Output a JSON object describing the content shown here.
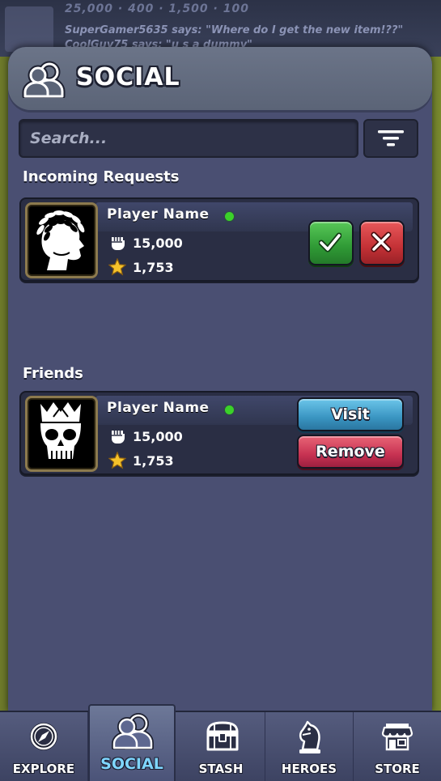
{
  "background": {
    "stats": "25,000   ·  400   ·   1,500   ·  100",
    "chat_line_1": "SuperGamer5635 says: \"Where do I get the new item!??\"",
    "chat_line_2": "CoolGuy75 says: \"u s a dummy\""
  },
  "panel": {
    "title": "SOCIAL",
    "title_icon": "friends-icon"
  },
  "search": {
    "placeholder": "Search...",
    "value": "",
    "filter_icon": "filter-icon"
  },
  "incoming": {
    "heading": "Incoming Requests",
    "requests": [
      {
        "avatar": "laurel-profile-avatar",
        "name": "Player Name",
        "online": true,
        "power": "15,000",
        "stars": "1,753"
      }
    ]
  },
  "friends": {
    "heading": "Friends",
    "list": [
      {
        "avatar": "crowned-skull-avatar",
        "name": "Player Name",
        "online": true,
        "power": "15,000",
        "stars": "1,753",
        "visit_label": "Visit",
        "remove_label": "Remove"
      }
    ]
  },
  "nav": {
    "active": "SOCIAL",
    "items": [
      {
        "label": "EXPLORE",
        "icon": "compass-icon"
      },
      {
        "label": "SOCIAL",
        "icon": "friends-icon"
      },
      {
        "label": "STASH",
        "icon": "chest-icon"
      },
      {
        "label": "HEROES",
        "icon": "knight-chess-icon"
      },
      {
        "label": "STORE",
        "icon": "shop-icon"
      }
    ]
  },
  "colors": {
    "online": "#3bd12a",
    "accept": "#2f9a35",
    "decline": "#c43136",
    "visit": "#3a95c2",
    "remove": "#c73252",
    "panel": "#4a4f72",
    "active_nav_label": "#7fd6ff"
  }
}
